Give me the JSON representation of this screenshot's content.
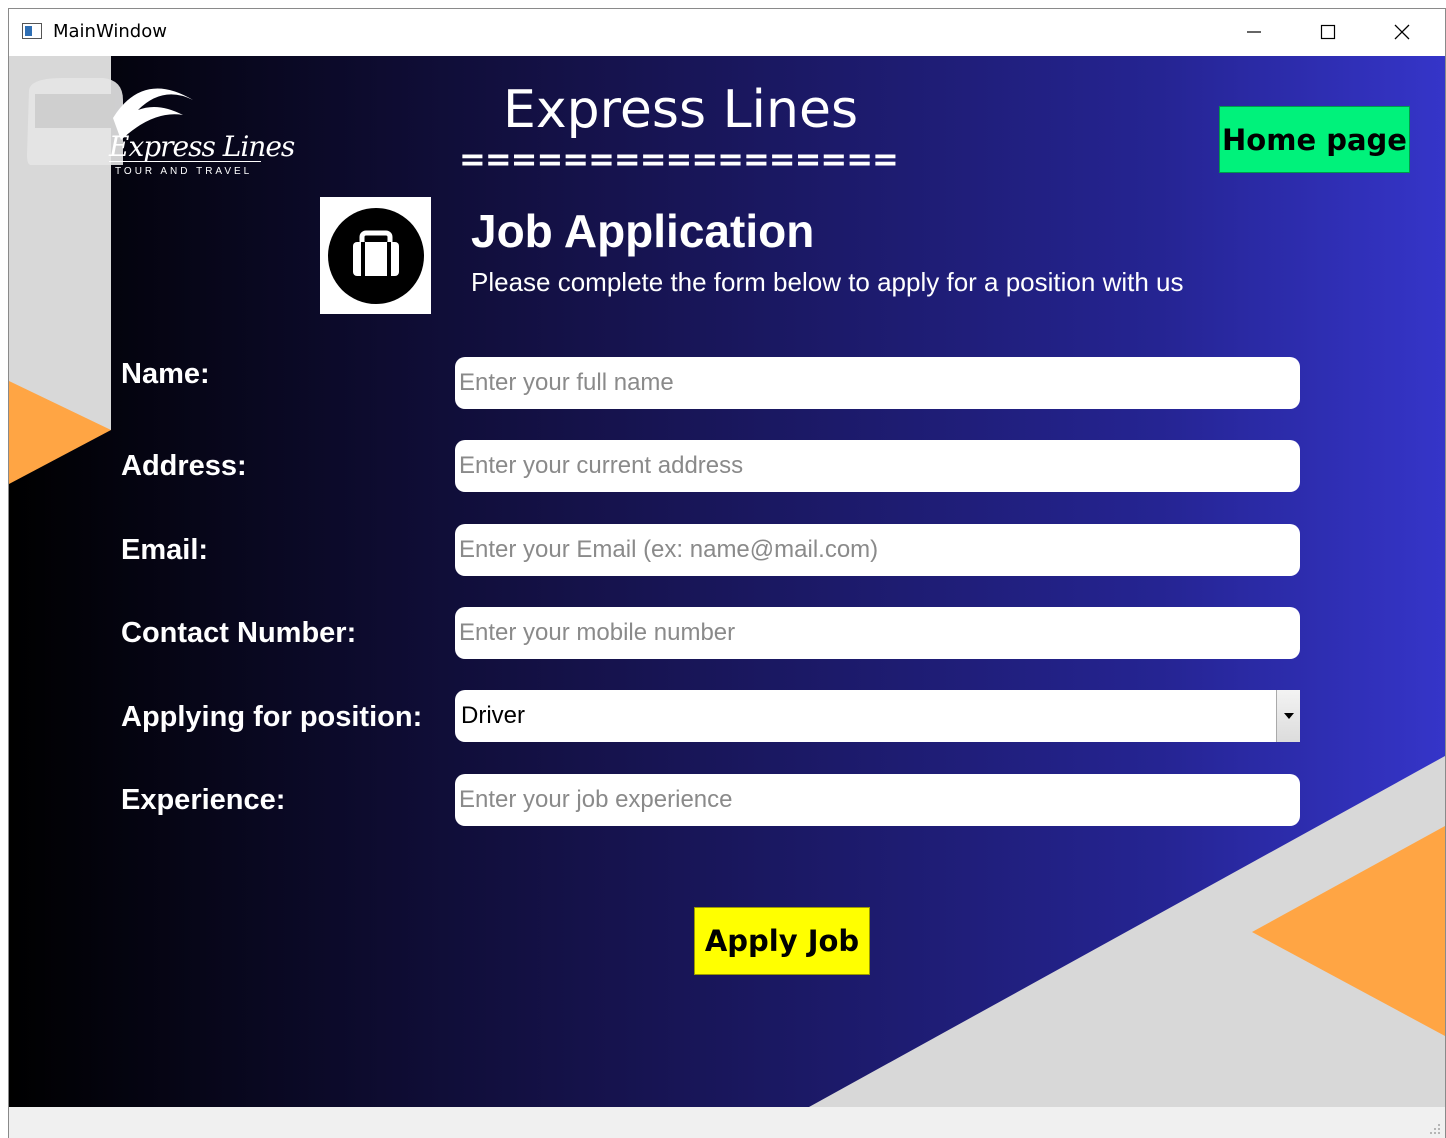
{
  "window": {
    "title": "MainWindow",
    "icons": {
      "app": "app-window-icon",
      "minimize": "minimize-icon",
      "maximize": "maximize-icon",
      "close": "close-icon"
    }
  },
  "header": {
    "logo_script": "Express Lines",
    "logo_tagline": "TOUR AND TRAVEL",
    "brand_title": "Express Lines",
    "brand_underline": "=================",
    "home_button": "Home page"
  },
  "intro": {
    "icon": "briefcase-icon",
    "title": "Job Application",
    "subtitle": "Please complete the form below to apply for a position with us"
  },
  "form": {
    "name": {
      "label": "Name:",
      "placeholder": "Enter your full name"
    },
    "address": {
      "label": "Address:",
      "placeholder": "Enter your current address"
    },
    "email": {
      "label": "Email:",
      "placeholder": "Enter your Email (ex: name@mail.com)"
    },
    "contact": {
      "label": "Contact Number:",
      "placeholder": "Enter your mobile number"
    },
    "position": {
      "label": "Applying for position:",
      "selected": "Driver"
    },
    "experience": {
      "label": "Experience:",
      "placeholder": "Enter your job experience"
    },
    "apply_button": "Apply Job"
  },
  "colors": {
    "background_start": "#000000",
    "background_end": "#3535c9",
    "home_button": "#00f27b",
    "apply_button": "#ffff00",
    "accent_orange": "#ffa544",
    "accent_grey": "#d8d8d8"
  }
}
